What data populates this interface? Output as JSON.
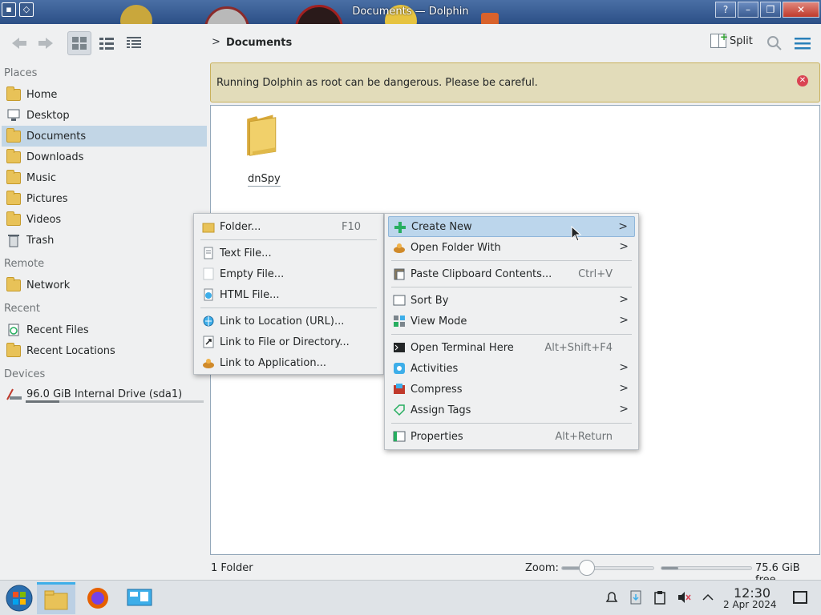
{
  "window": {
    "title": "Documents — Dolphin"
  },
  "toolbar": {
    "breadcrumb": "Documents",
    "split_label": "Split"
  },
  "sidebar": {
    "sections": {
      "places": "Places",
      "remote": "Remote",
      "recent": "Recent",
      "devices": "Devices"
    },
    "places": [
      {
        "label": "Home"
      },
      {
        "label": "Desktop"
      },
      {
        "label": "Documents",
        "selected": true
      },
      {
        "label": "Downloads"
      },
      {
        "label": "Music"
      },
      {
        "label": "Pictures"
      },
      {
        "label": "Videos"
      },
      {
        "label": "Trash"
      }
    ],
    "remote": [
      {
        "label": "Network"
      }
    ],
    "recent": [
      {
        "label": "Recent Files"
      },
      {
        "label": "Recent Locations"
      }
    ],
    "devices": [
      {
        "label": "96.0 GiB Internal Drive (sda1)",
        "usage": 0.19
      }
    ]
  },
  "banner": {
    "text": "Running Dolphin as root can be dangerous. Please be careful."
  },
  "view": {
    "items": [
      {
        "name": "dnSpy",
        "type": "folder"
      }
    ]
  },
  "context_menu": {
    "items": [
      {
        "label": "Create New",
        "icon": "plus-icon",
        "submenu": true,
        "highlighted": true
      },
      {
        "label": "Open Folder With",
        "icon": "open-with-icon",
        "submenu": true
      },
      {
        "label": "Paste Clipboard Contents...",
        "icon": "paste-icon",
        "shortcut": "Ctrl+V"
      },
      {
        "label": "Sort By",
        "icon": "sort-icon",
        "submenu": true
      },
      {
        "label": "View Mode",
        "icon": "view-mode-icon",
        "submenu": true
      },
      {
        "label": "Open Terminal Here",
        "icon": "terminal-icon",
        "shortcut": "Alt+Shift+F4"
      },
      {
        "label": "Activities",
        "icon": "activities-icon",
        "submenu": true
      },
      {
        "label": "Compress",
        "icon": "compress-icon",
        "submenu": true
      },
      {
        "label": "Assign Tags",
        "icon": "tag-icon",
        "submenu": true
      },
      {
        "label": "Properties",
        "icon": "properties-icon",
        "shortcut": "Alt+Return"
      }
    ]
  },
  "create_new_menu": {
    "items": [
      {
        "label": "Folder...",
        "icon": "folder-icon",
        "shortcut": "F10"
      },
      {
        "label": "Text File...",
        "icon": "text-file-icon"
      },
      {
        "label": "Empty File...",
        "icon": "empty-file-icon"
      },
      {
        "label": "HTML File...",
        "icon": "html-file-icon"
      },
      {
        "label": "Link to Location (URL)...",
        "icon": "link-url-icon"
      },
      {
        "label": "Link to File or Directory...",
        "icon": "link-file-icon"
      },
      {
        "label": "Link to Application...",
        "icon": "link-app-icon"
      }
    ]
  },
  "statusbar": {
    "count": "1 Folder",
    "zoom_label": "Zoom:",
    "zoom_level": 0.2,
    "free_space": "75.6 GiB free",
    "used_fraction": 0.19
  },
  "taskbar": {
    "apps": [
      {
        "name": "start-menu"
      },
      {
        "name": "dolphin",
        "active": true
      },
      {
        "name": "firefox"
      },
      {
        "name": "system-settings"
      }
    ],
    "clock_time": "12:30",
    "clock_date": "2 Apr 2024"
  },
  "colors": {
    "accent": "#3daee9",
    "selection": "#c2d6e6",
    "banner_bg": "#e2dcba",
    "banner_border": "#c9b15d",
    "close_red": "#da4453"
  }
}
